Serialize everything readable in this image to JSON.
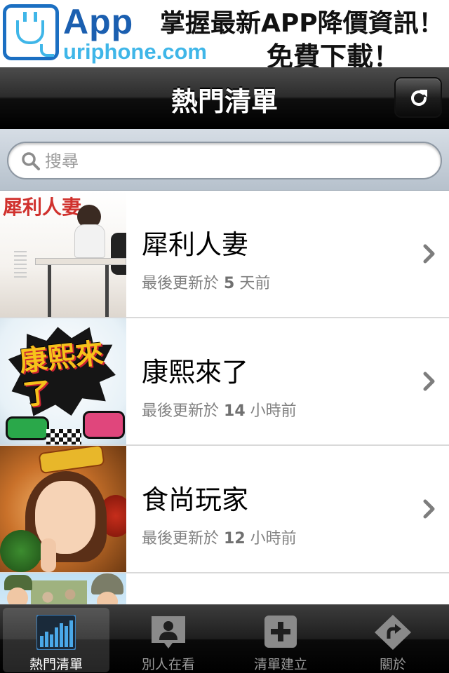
{
  "ad": {
    "brand": "App",
    "site": "uriphone.com",
    "line1": "掌握最新APP降價資訊！",
    "line2": "免費下載！",
    "icon": "plug-logo-icon"
  },
  "navbar": {
    "title": "熱門清單",
    "refresh_icon": "refresh-icon"
  },
  "search": {
    "placeholder": "搜尋",
    "value": ""
  },
  "list": {
    "updated_prefix": "最後更新於",
    "items": [
      {
        "title": "犀利人妻",
        "updated_amount": "5",
        "updated_unit": "天前",
        "thumb_caption": "犀利人妻。"
      },
      {
        "title": "康熙來了",
        "updated_amount": "14",
        "updated_unit": "小時前",
        "thumb_caption": "康熙來了"
      },
      {
        "title": "食尚玩家",
        "updated_amount": "12",
        "updated_unit": "小時前"
      },
      {
        "title": "",
        "updated_amount": "",
        "updated_unit": ""
      }
    ]
  },
  "tabs": [
    {
      "label": "熱門清單",
      "icon": "bar-chart-icon",
      "active": true
    },
    {
      "label": "別人在看",
      "icon": "person-icon",
      "active": false
    },
    {
      "label": "清單建立",
      "icon": "plus-icon",
      "active": false
    },
    {
      "label": "關於",
      "icon": "turn-sign-icon",
      "active": false
    }
  ],
  "colors": {
    "accent_blue": "#1b5fb0",
    "light_blue": "#3fb6e8",
    "navbar": "#1e1e1e",
    "tab_active_icon": "#4aa8e8"
  }
}
